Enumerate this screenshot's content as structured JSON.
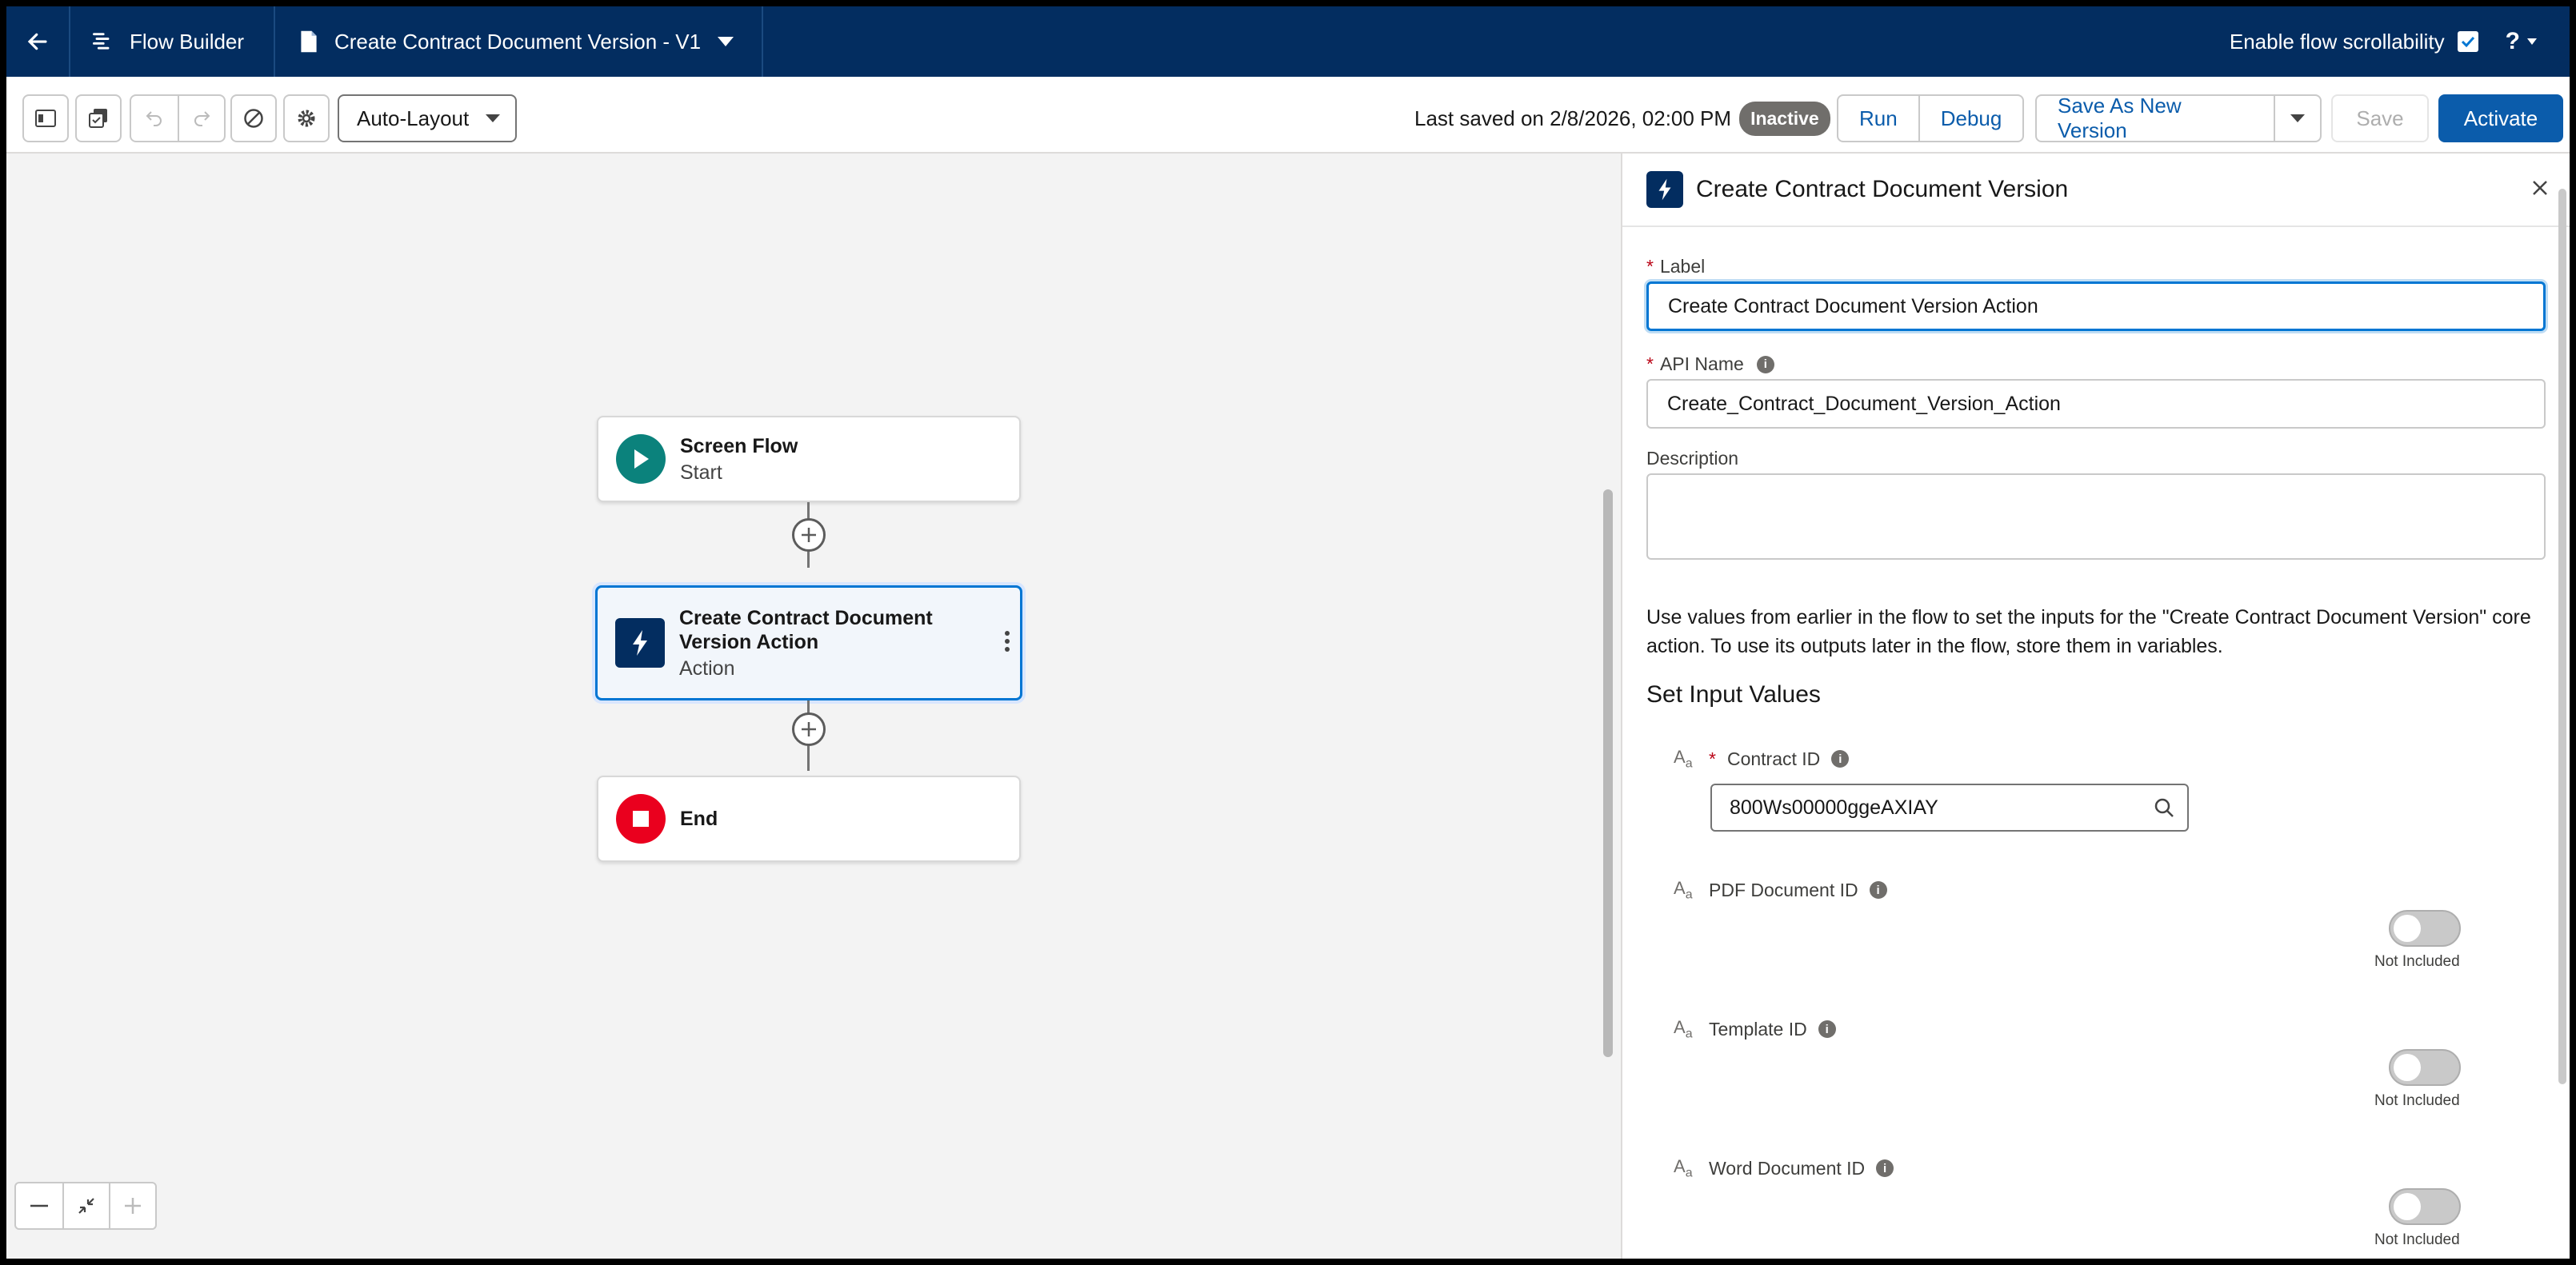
{
  "header": {
    "app_name": "Flow Builder",
    "flow_title": "Create Contract Document Version - V1",
    "scroll_label": "Enable flow scrollability",
    "help_label": "?"
  },
  "toolbar": {
    "layout_mode": "Auto-Layout",
    "last_saved": "Last saved on 2/8/2026, 02:00 PM",
    "status_badge": "Inactive",
    "run": "Run",
    "debug": "Debug",
    "save_as_new": "Save As New Version",
    "save": "Save",
    "activate": "Activate"
  },
  "canvas": {
    "start_title": "Screen Flow",
    "start_sub": "Start",
    "action_title": "Create Contract Document Version Action",
    "action_sub": "Action",
    "end_title": "End"
  },
  "panel": {
    "title": "Create Contract Document Version",
    "label_field": "Label",
    "label_value": "Create Contract Document Version Action",
    "api_field": "API Name",
    "api_value": "Create_Contract_Document_Version_Action",
    "description_field": "Description",
    "help_text": "Use values from earlier in the flow to set the inputs for the \"Create Contract Document Version\" core action. To use its outputs later in the flow, store them in variables.",
    "section_title": "Set Input Values",
    "params": [
      {
        "label": "Contract ID",
        "value": "800Ws00000ggeAXIAY"
      },
      {
        "label": "PDF Document ID",
        "toggle": "Not Included"
      },
      {
        "label": "Template ID",
        "toggle": "Not Included"
      },
      {
        "label": "Word Document ID",
        "toggle": "Not Included"
      }
    ]
  },
  "colors": {
    "brand_header": "#032d60",
    "accent": "#0b5cab",
    "start": "#0b827c",
    "end": "#ea001e"
  }
}
